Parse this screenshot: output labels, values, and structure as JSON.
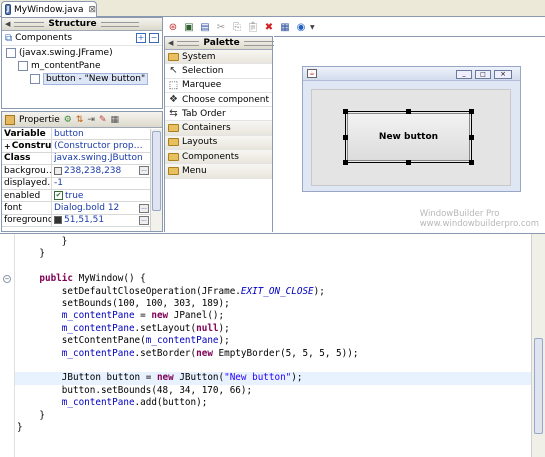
{
  "editor_tab": {
    "title": "MyWindow.java",
    "icon_glyph": "J",
    "close_glyph": "⊠"
  },
  "structure": {
    "title": "Structure",
    "components_title": "Components",
    "tree": [
      {
        "label": "(javax.swing.JFrame)",
        "indent": 1,
        "selected": false
      },
      {
        "label": "m_contentPane",
        "indent": 2,
        "selected": false
      },
      {
        "label": "button - \"New button\"",
        "indent": 3,
        "selected": true
      }
    ]
  },
  "properties": {
    "title": "Propertie",
    "rows": [
      {
        "key": "Variable",
        "value": "button",
        "bold": true,
        "swatch": "",
        "check": false,
        "button": false
      },
      {
        "key": "Constructo…",
        "value": "(Constructor prop…",
        "bold": true,
        "swatch": "",
        "check": false,
        "button": false,
        "expand": "+"
      },
      {
        "key": "Class",
        "value": "javax.swing.JButton",
        "bold": true,
        "swatch": "",
        "check": false,
        "button": false
      },
      {
        "key": "backgrou…",
        "value": "238,238,238",
        "bold": false,
        "swatch": "#eeeeee",
        "check": false,
        "button": true
      },
      {
        "key": "displayed…",
        "value": "-1",
        "bold": false,
        "swatch": "",
        "check": false,
        "button": false
      },
      {
        "key": "enabled",
        "value": "true",
        "bold": false,
        "swatch": "",
        "check": true,
        "button": false
      },
      {
        "key": "font",
        "value": "Dialog.bold 12",
        "bold": false,
        "swatch": "",
        "check": false,
        "button": true
      },
      {
        "key": "foreground",
        "value": "51,51,51",
        "bold": false,
        "swatch": "#333333",
        "check": false,
        "button": true
      }
    ]
  },
  "palette": {
    "title": "Palette",
    "items": [
      {
        "label": "System",
        "icon": "folder",
        "category": true
      },
      {
        "label": "Selection",
        "icon": "arrow",
        "category": false,
        "selected": true
      },
      {
        "label": "Marquee",
        "icon": "marquee",
        "category": false
      },
      {
        "label": "Choose component",
        "icon": "choose",
        "category": false
      },
      {
        "label": "Tab Order",
        "icon": "taborder",
        "category": false
      },
      {
        "label": "Containers",
        "icon": "folder",
        "category": true
      },
      {
        "label": "Layouts",
        "icon": "folder",
        "category": true
      },
      {
        "label": "Components",
        "icon": "folder",
        "category": true
      },
      {
        "label": "Menu",
        "icon": "folder",
        "category": true
      }
    ]
  },
  "design": {
    "button_label": "New button",
    "watermark_line1": "WindowBuilder Pro",
    "watermark_line2": "www.windowbuilderpro.com"
  },
  "code_lines": [
    [
      {
        "t": "        }",
        "c": ""
      }
    ],
    [
      {
        "t": "    }",
        "c": ""
      }
    ],
    [
      {
        "t": "",
        "c": ""
      }
    ],
    [
      {
        "t": "    ",
        "c": ""
      },
      {
        "t": "public",
        "c": "kw"
      },
      {
        "t": " MyWindow() {",
        "c": ""
      }
    ],
    [
      {
        "t": "        setDefaultCloseOperation(JFrame.",
        "c": ""
      },
      {
        "t": "EXIT_ON_CLOSE",
        "c": "st"
      },
      {
        "t": ");",
        "c": ""
      }
    ],
    [
      {
        "t": "        setBounds(100, 100, 303, 189);",
        "c": ""
      }
    ],
    [
      {
        "t": "        ",
        "c": ""
      },
      {
        "t": "m_contentPane",
        "c": "fld"
      },
      {
        "t": " = ",
        "c": ""
      },
      {
        "t": "new",
        "c": "kw"
      },
      {
        "t": " JPanel();",
        "c": ""
      }
    ],
    [
      {
        "t": "        ",
        "c": ""
      },
      {
        "t": "m_contentPane",
        "c": "fld"
      },
      {
        "t": ".setLayout(",
        "c": ""
      },
      {
        "t": "null",
        "c": "kw"
      },
      {
        "t": ");",
        "c": ""
      }
    ],
    [
      {
        "t": "        setContentPane(",
        "c": ""
      },
      {
        "t": "m_contentPane",
        "c": "fld"
      },
      {
        "t": ");",
        "c": ""
      }
    ],
    [
      {
        "t": "        ",
        "c": ""
      },
      {
        "t": "m_contentPane",
        "c": "fld"
      },
      {
        "t": ".setBorder(",
        "c": ""
      },
      {
        "t": "new",
        "c": "kw"
      },
      {
        "t": " EmptyBorder(5, 5, 5, 5));",
        "c": ""
      }
    ],
    [
      {
        "t": "",
        "c": ""
      }
    ],
    [
      {
        "t": "        JButton button = ",
        "c": ""
      },
      {
        "t": "new",
        "c": "kw"
      },
      {
        "t": " JButton(",
        "c": ""
      },
      {
        "t": "\"New button\"",
        "c": "str"
      },
      {
        "t": ");",
        "c": ""
      }
    ],
    [
      {
        "t": "        button.setBounds(48, 34, 170, 66);",
        "c": ""
      }
    ],
    [
      {
        "t": "        ",
        "c": ""
      },
      {
        "t": "m_contentPane",
        "c": "fld"
      },
      {
        "t": ".add(button);",
        "c": ""
      }
    ],
    [
      {
        "t": "    }",
        "c": ""
      }
    ],
    [
      {
        "t": "}",
        "c": ""
      }
    ]
  ],
  "code_highlight_line": 11,
  "colors": {
    "keyword": "#7f0055",
    "field": "#0000c0",
    "string": "#2a00ff",
    "selection": "#c5d5f5"
  }
}
